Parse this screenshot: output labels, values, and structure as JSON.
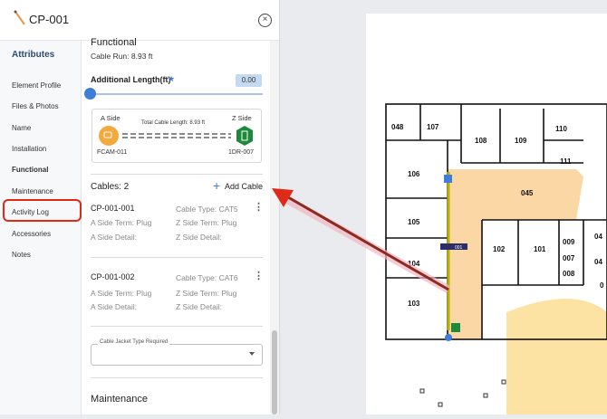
{
  "header": {
    "title": "CP-001"
  },
  "sidebar": {
    "heading": "Attributes",
    "items": [
      {
        "label": "Element Profile"
      },
      {
        "label": "Files & Photos"
      },
      {
        "label": "Name"
      },
      {
        "label": "Installation"
      },
      {
        "label": "Functional"
      },
      {
        "label": "Maintenance"
      },
      {
        "label": "Activity Log"
      },
      {
        "label": "Accessories"
      },
      {
        "label": "Notes"
      }
    ],
    "active": "Functional"
  },
  "functional": {
    "title": "Functional",
    "cable_run": "Cable Run: 8.93 ft",
    "additional_length_label": "Additional Length(ft)",
    "additional_length_value": "0.00",
    "additional_length_fraction": 0,
    "a_side_label": "A Side",
    "z_side_label": "Z Side",
    "total_length": "Total Cable Length: 8.93 ft",
    "a_side_device": "FCAM-011",
    "z_side_device": "1DR-007"
  },
  "cables": {
    "title": "Cables: 2",
    "add_label": "Add Cable",
    "items": [
      {
        "name": "CP-001-001",
        "type": "Cable Type: CAT5",
        "a_term": "A Side Term: Plug",
        "z_term": "Z Side Term: Plug",
        "a_detail": "A Side Detail:",
        "z_detail": "Z Side Detail:"
      },
      {
        "name": "CP-001-002",
        "type": "Cable Type: CAT6",
        "a_term": "A Side Term: Plug",
        "z_term": "Z Side Term: Plug",
        "a_detail": "A Side Detail:",
        "z_detail": "Z Side Detail:"
      }
    ]
  },
  "jacket": {
    "label": "Cable Jacket Type Required",
    "value": ""
  },
  "maintenance": {
    "title": "Maintenance"
  },
  "map": {
    "rooms": [
      "048",
      "107",
      "108",
      "109",
      "110",
      "111",
      "106",
      "045",
      "105",
      "102",
      "101",
      "009",
      "007",
      "008",
      "104",
      "103",
      "04",
      "04",
      "0"
    ],
    "marker_label": "001"
  },
  "colors": {
    "accent": "#3f7ed8",
    "highlight": "#e02a17",
    "a_side": "#f4a93c",
    "z_side": "#1c8a3a",
    "zone": "#fbd7a5"
  }
}
